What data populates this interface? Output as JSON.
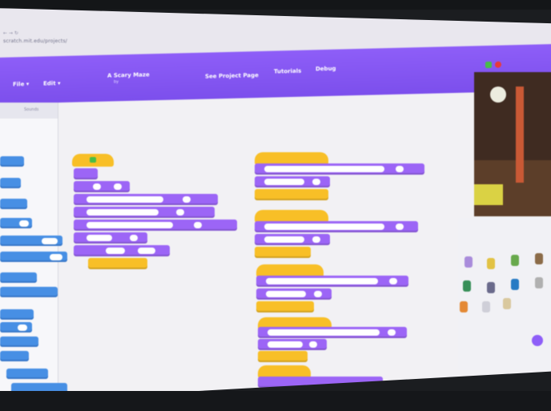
{
  "browser": {
    "tab_controls": "← → ↻",
    "url": "scratch.mit.edu/projects/"
  },
  "menubar": {
    "file_label": "File ▾",
    "edit_label": "Edit ▾",
    "project_title": "A Scary Maze",
    "author": "by",
    "see_project_page": "See Project Page",
    "tutorials": "Tutorials",
    "debug": "Debug"
  },
  "palette": {
    "tab_label": "Sounds"
  },
  "colors": {
    "scratch_purple": "#8d5ff2",
    "events_yellow": "#f5bf2e",
    "looks_purple": "#9a66f0",
    "motion_blue": "#4a8fe0"
  },
  "icons": [
    "file-icon",
    "edit-icon",
    "green-flag-icon",
    "stop-icon",
    "add-sprite-icon"
  ]
}
